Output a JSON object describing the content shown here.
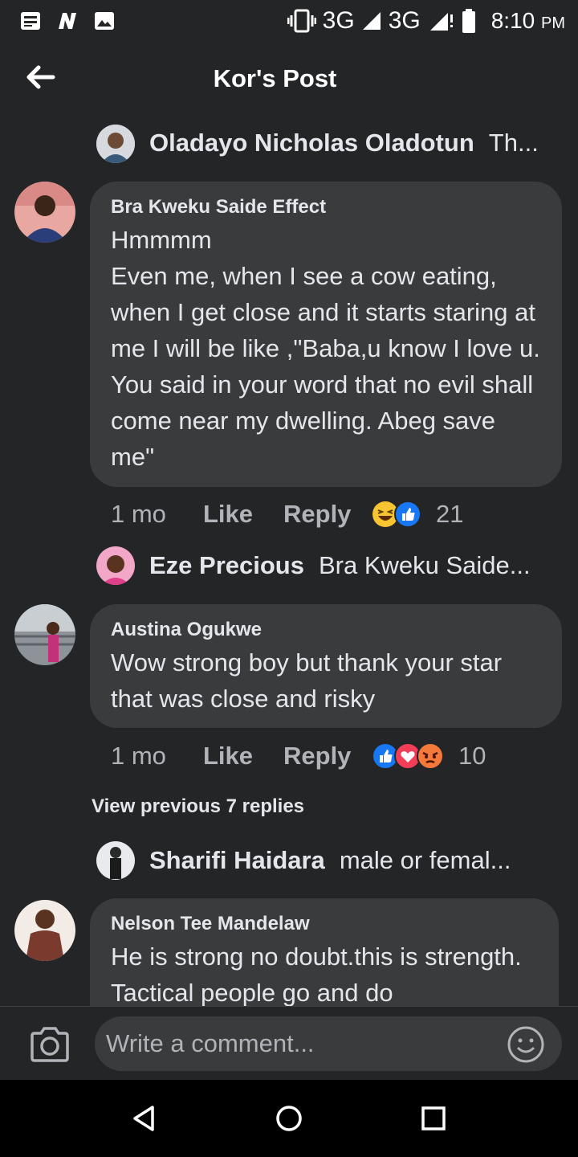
{
  "status_bar": {
    "network1": "3G",
    "network2": "3G",
    "network2_sup": "H+",
    "time": "8:10",
    "ampm": "PM",
    "icons": [
      "news-icon",
      "n-app-icon",
      "image-icon",
      "vibrate-icon",
      "signal-icon",
      "battery-icon"
    ]
  },
  "header": {
    "title": "Kor's Post",
    "back_icon": "back-arrow-icon"
  },
  "comments": [
    {
      "reply_preview": {
        "name": "Oladayo Nicholas Oladotun",
        "text": "Th..."
      }
    },
    {
      "author": "Bra Kweku Saide Effect",
      "text": "Hmmmm\nEven me, when I see a cow eating, when I get close and it starts staring at me I will be like ,\"Baba,u know I love u. You said in your word that no evil shall come near my dwelling. Abeg save me\"",
      "time": "1 mo",
      "like": "Like",
      "reply": "Reply",
      "reaction_count": "21",
      "reactions": [
        "haha",
        "like"
      ]
    },
    {
      "reply_preview": {
        "name": "Eze Precious",
        "text": "Bra Kweku Saide..."
      }
    },
    {
      "author": "Austina Ogukwe",
      "text": "Wow strong boy but thank your star that was close and risky",
      "time": "1 mo",
      "like": "Like",
      "reply": "Reply",
      "reaction_count": "10",
      "reactions": [
        "like",
        "love",
        "angry"
      ]
    },
    {
      "view_previous": "View previous 7 replies"
    },
    {
      "reply_preview": {
        "name": "Sharifi Haidara",
        "text": "male or femal..."
      }
    },
    {
      "author": "Nelson Tee Mandelaw",
      "text": "He is strong no doubt.this is strength. Tactical people go and do"
    }
  ],
  "composer": {
    "placeholder": "Write a comment...",
    "camera_icon": "camera-icon",
    "emoji_icon": "smiley-icon"
  },
  "colors": {
    "background": "#242527",
    "bubble": "#3a3b3c",
    "text": "#e4e6eb",
    "muted": "#b0b3b8",
    "like_blue": "#1877f2"
  }
}
